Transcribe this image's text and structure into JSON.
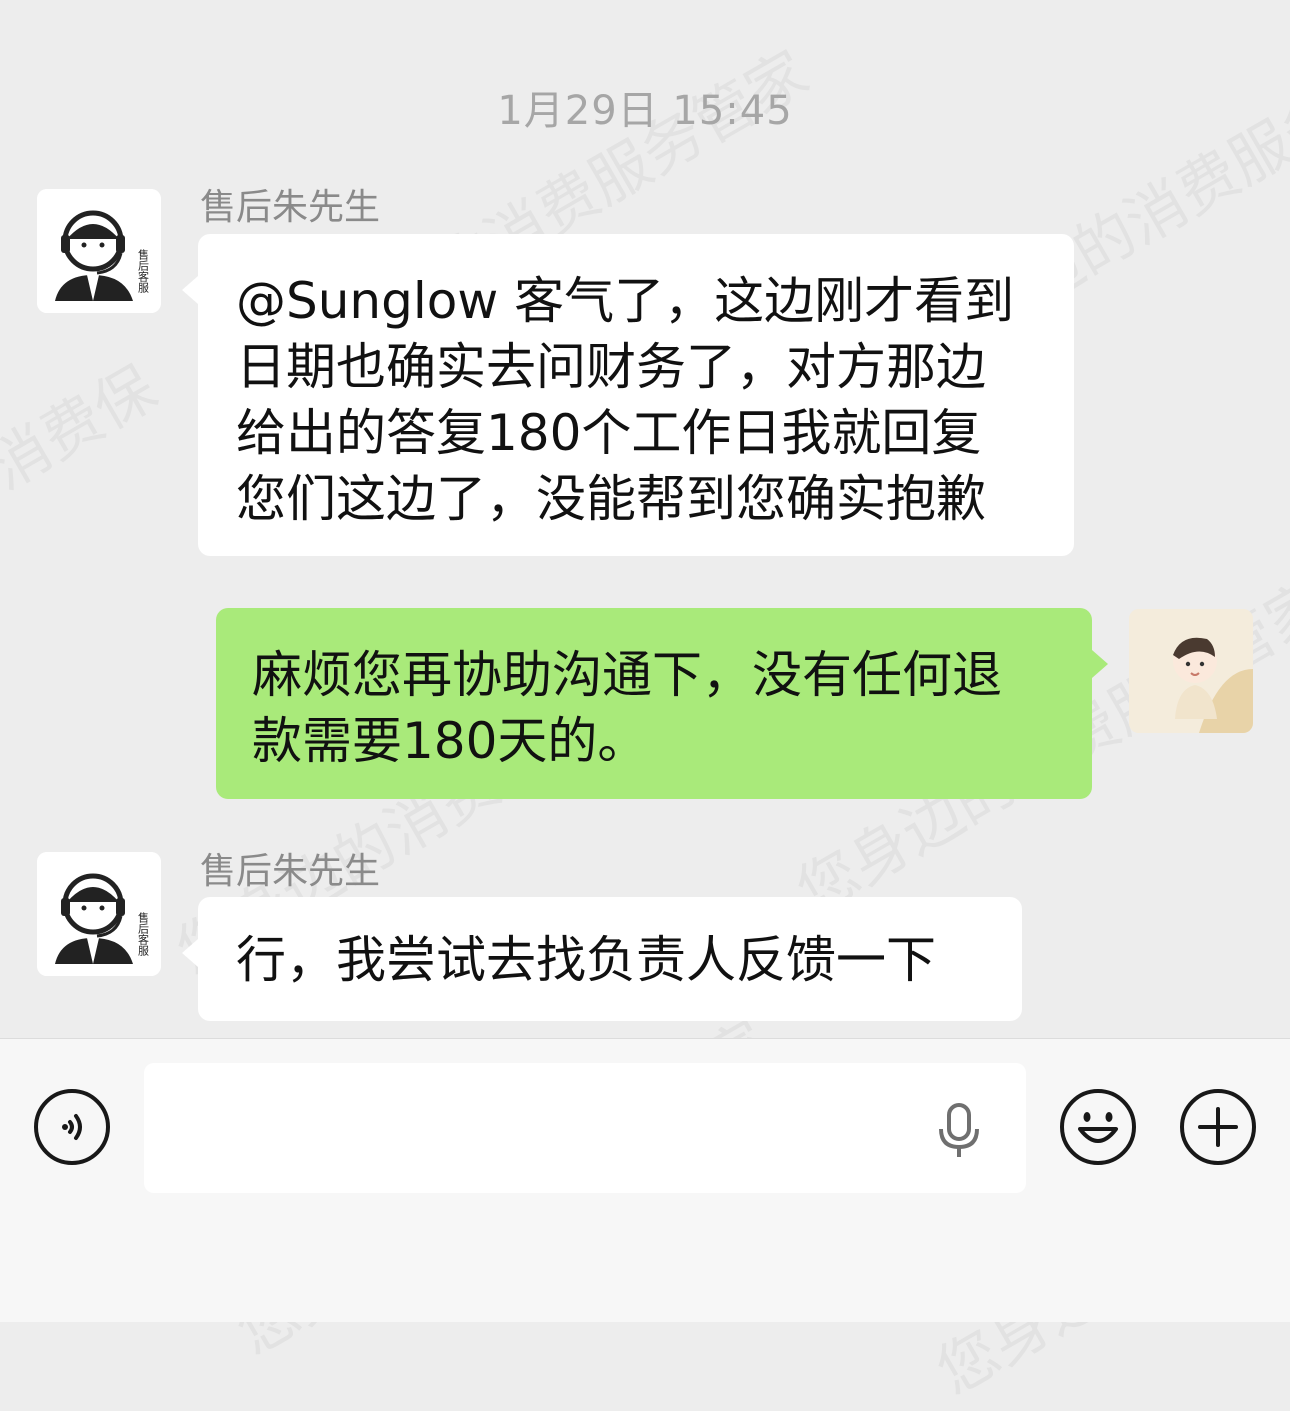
{
  "chat": {
    "timestamp": "1月29日 15:45",
    "messages": [
      {
        "side": "left",
        "sender": "售后朱先生",
        "avatar_text": "售后客服",
        "lines": [
          "@Sunglow 客气了，这边刚才看到",
          "日期也确实去问财务了，对方那边",
          "给出的答复180个工作日我就回复",
          "您们这边了，没能帮到您确实抱歉"
        ]
      },
      {
        "side": "right",
        "lines": [
          "麻烦您再协助沟通下，没有任何退",
          "款需要180天的。"
        ]
      },
      {
        "side": "left",
        "sender": "售后朱先生",
        "avatar_text": "售后客服",
        "lines": [
          "行，我尝试去找负责人反馈一下"
        ]
      }
    ]
  },
  "input_bar": {
    "voice_icon": "voice-toggle-icon",
    "mic_icon": "microphone-icon",
    "emoji_icon": "emoji-icon",
    "more_icon": "plus-icon"
  },
  "watermark": {
    "text_a": "消费保",
    "text_b": "您身边的消费服务管家"
  },
  "colors": {
    "background": "#ededed",
    "incoming_bubble": "#ffffff",
    "outgoing_bubble": "#a9ea7a",
    "meta_text": "#8a8a8a"
  }
}
